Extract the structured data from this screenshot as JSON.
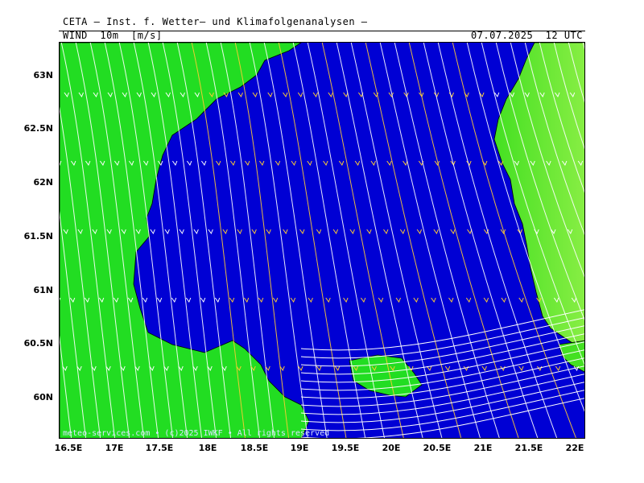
{
  "header": {
    "title": "CETA – Inst. f. Wetter– und Klimafolgenanalysen –",
    "parameter": "WIND  10m  [m/s]",
    "valid_time": "07.07.2025  12 UTC"
  },
  "map": {
    "lat_labels": [
      "63N",
      "62.5N",
      "62N",
      "61.5N",
      "61N",
      "60.5N",
      "60N"
    ],
    "lon_labels": [
      "16.5E",
      "17E",
      "17.5E",
      "18E",
      "18.5E",
      "19E",
      "19.5E",
      "20E",
      "20.5E",
      "21E",
      "21.5E",
      "22E"
    ],
    "colors": {
      "sea": "#0000d4",
      "land": "#22dd22",
      "land_light": "#66ee33",
      "streamline_strong": "#ffcc33",
      "streamline_weak": "#ffffff"
    }
  },
  "credit": "meteo-services.com • (c)2025 IWKF • All rights reserved"
}
